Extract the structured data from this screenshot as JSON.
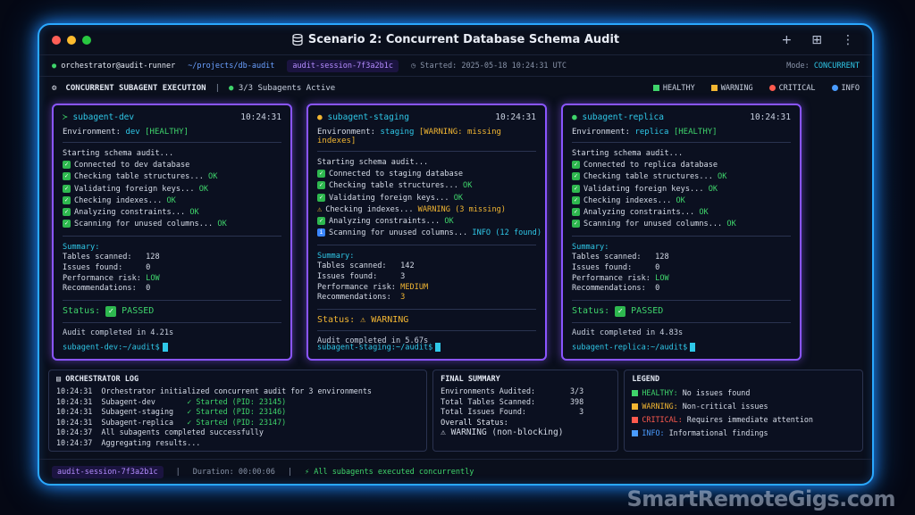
{
  "window": {
    "title": "Scenario 2: Concurrent Database Schema Audit",
    "actions": [
      "+",
      "⊞",
      "⋮"
    ]
  },
  "statusbar": {
    "user": "orchestrator@audit-runner",
    "path": "~/projects/db-audit",
    "session": "audit-session-7f3a2b1c",
    "started": "Started: 2025-05-18 10:24:31 UTC",
    "mode_label": "Mode:",
    "mode": "CONCURRENT"
  },
  "exec": {
    "title": "CONCURRENT SUBAGENT EXECUTION",
    "active": "3/3 Subagents Active"
  },
  "legend_inline": [
    "HEALTHY",
    "WARNING",
    "CRITICAL",
    "INFO"
  ],
  "colors": {
    "healthy": "#3fd46b",
    "warning": "#f2b632",
    "critical": "#ff5a4e",
    "info": "#4a9cff",
    "accent": "#8a55ff"
  },
  "panels": [
    {
      "name": "subagent-dev",
      "icon": "prompt-icon",
      "time": "10:24:31",
      "env_label": "Environment:",
      "env": "dev",
      "env_status": "[HEALTHY]",
      "status_type": "healthy",
      "start": "Starting schema audit...",
      "lines": [
        {
          "kind": "ok",
          "text": "Connected to dev database",
          "suffix": ""
        },
        {
          "kind": "ok",
          "text": "Checking table structures...",
          "suffix": "OK"
        },
        {
          "kind": "ok",
          "text": "Validating foreign keys...",
          "suffix": "OK"
        },
        {
          "kind": "ok",
          "text": "Checking indexes...",
          "suffix": "OK"
        },
        {
          "kind": "ok",
          "text": "Analyzing constraints...",
          "suffix": "OK"
        },
        {
          "kind": "ok",
          "text": "Scanning for unused columns...",
          "suffix": "OK"
        }
      ],
      "summary_label": "Summary:",
      "tables": "Tables scanned:   128",
      "issues": "Issues found:     0",
      "risk_label": "Performance risk: ",
      "risk": "LOW",
      "recs_label": "Recommendations:  ",
      "recs": "0",
      "status_label": "Status:",
      "status": "PASSED",
      "completed": "Audit completed in 4.21s",
      "prompt": "subagent-dev:~/audit$"
    },
    {
      "name": "subagent-staging",
      "icon": "warning-dot-icon",
      "time": "10:24:31",
      "env_label": "Environment:",
      "env": "staging",
      "env_status": "[WARNING: missing indexes]",
      "status_type": "warning",
      "start": "Starting schema audit...",
      "lines": [
        {
          "kind": "ok",
          "text": "Connected to staging database",
          "suffix": ""
        },
        {
          "kind": "ok",
          "text": "Checking table structures...",
          "suffix": "OK"
        },
        {
          "kind": "ok",
          "text": "Validating foreign keys...",
          "suffix": "OK"
        },
        {
          "kind": "warn",
          "text": "Checking indexes...",
          "suffix": "WARNING (3 missing)"
        },
        {
          "kind": "ok",
          "text": "Analyzing constraints...",
          "suffix": "OK"
        },
        {
          "kind": "info",
          "text": "Scanning for unused columns...",
          "suffix": "INFO (12 found)"
        }
      ],
      "summary_label": "Summary:",
      "tables": "Tables scanned:   142",
      "issues": "Issues found:     3",
      "risk_label": "Performance risk: ",
      "risk": "MEDIUM",
      "recs_label": "Recommendations:  ",
      "recs": "3",
      "status_label": "Status:",
      "status": "WARNING",
      "completed": "Audit completed in 5.67s",
      "prompt": "subagent-staging:~/audit$"
    },
    {
      "name": "subagent-replica",
      "icon": "healthy-dot-icon",
      "time": "10:24:31",
      "env_label": "Environment:",
      "env": "replica",
      "env_status": "[HEALTHY]",
      "status_type": "healthy",
      "start": "Starting schema audit...",
      "lines": [
        {
          "kind": "ok",
          "text": "Connected to replica database",
          "suffix": ""
        },
        {
          "kind": "ok",
          "text": "Checking table structures...",
          "suffix": "OK"
        },
        {
          "kind": "ok",
          "text": "Validating foreign keys...",
          "suffix": "OK"
        },
        {
          "kind": "ok",
          "text": "Checking indexes...",
          "suffix": "OK"
        },
        {
          "kind": "ok",
          "text": "Analyzing constraints...",
          "suffix": "OK"
        },
        {
          "kind": "ok",
          "text": "Scanning for unused columns...",
          "suffix": "OK"
        }
      ],
      "summary_label": "Summary:",
      "tables": "Tables scanned:   128",
      "issues": "Issues found:     0",
      "risk_label": "Performance risk: ",
      "risk": "LOW",
      "recs_label": "Recommendations:  ",
      "recs": "0",
      "status_label": "Status:",
      "status": "PASSED",
      "completed": "Audit completed in 4.83s",
      "prompt": "subagent-replica:~/audit$"
    }
  ],
  "log": {
    "title": "ORCHESTRATOR LOG",
    "rows": [
      {
        "t": "10:24:31",
        "msg": "Orchestrator initialized concurrent audit for 3 environments",
        "ok": ""
      },
      {
        "t": "10:24:31",
        "msg": "Subagent-dev       ",
        "ok": "✓ Started (PID: 23145)"
      },
      {
        "t": "10:24:31",
        "msg": "Subagent-staging   ",
        "ok": "✓ Started (PID: 23146)"
      },
      {
        "t": "10:24:31",
        "msg": "Subagent-replica   ",
        "ok": "✓ Started (PID: 23147)"
      },
      {
        "t": "10:24:37",
        "msg": "All subagents completed successfully",
        "ok": ""
      },
      {
        "t": "10:24:37",
        "msg": "Aggregating results...",
        "ok": ""
      }
    ]
  },
  "final": {
    "title": "FINAL SUMMARY",
    "rows": [
      {
        "k": "Environments Audited:",
        "v": "3/3"
      },
      {
        "k": "Total Tables Scanned:",
        "v": "398"
      },
      {
        "k": "Total Issues Found:",
        "v": "3"
      }
    ],
    "overall_label": "Overall Status:",
    "overall": "WARNING (non-blocking)"
  },
  "legend": {
    "title": "LEGEND",
    "rows": [
      {
        "key": "HEALTHY:",
        "desc": "No issues found",
        "cls": "green"
      },
      {
        "key": "WARNING:",
        "desc": "Non-critical issues",
        "cls": "yellow"
      },
      {
        "key": "CRITICAL:",
        "desc": "Requires immediate attention",
        "cls": "red"
      },
      {
        "key": "INFO:",
        "desc": "Informational findings",
        "cls": "blue"
      }
    ]
  },
  "footer": {
    "session": "audit-session-7f3a2b1c",
    "duration": "Duration: 00:00:06",
    "note": "All subagents executed concurrently"
  },
  "watermark": "SmartRemoteGigs.com"
}
